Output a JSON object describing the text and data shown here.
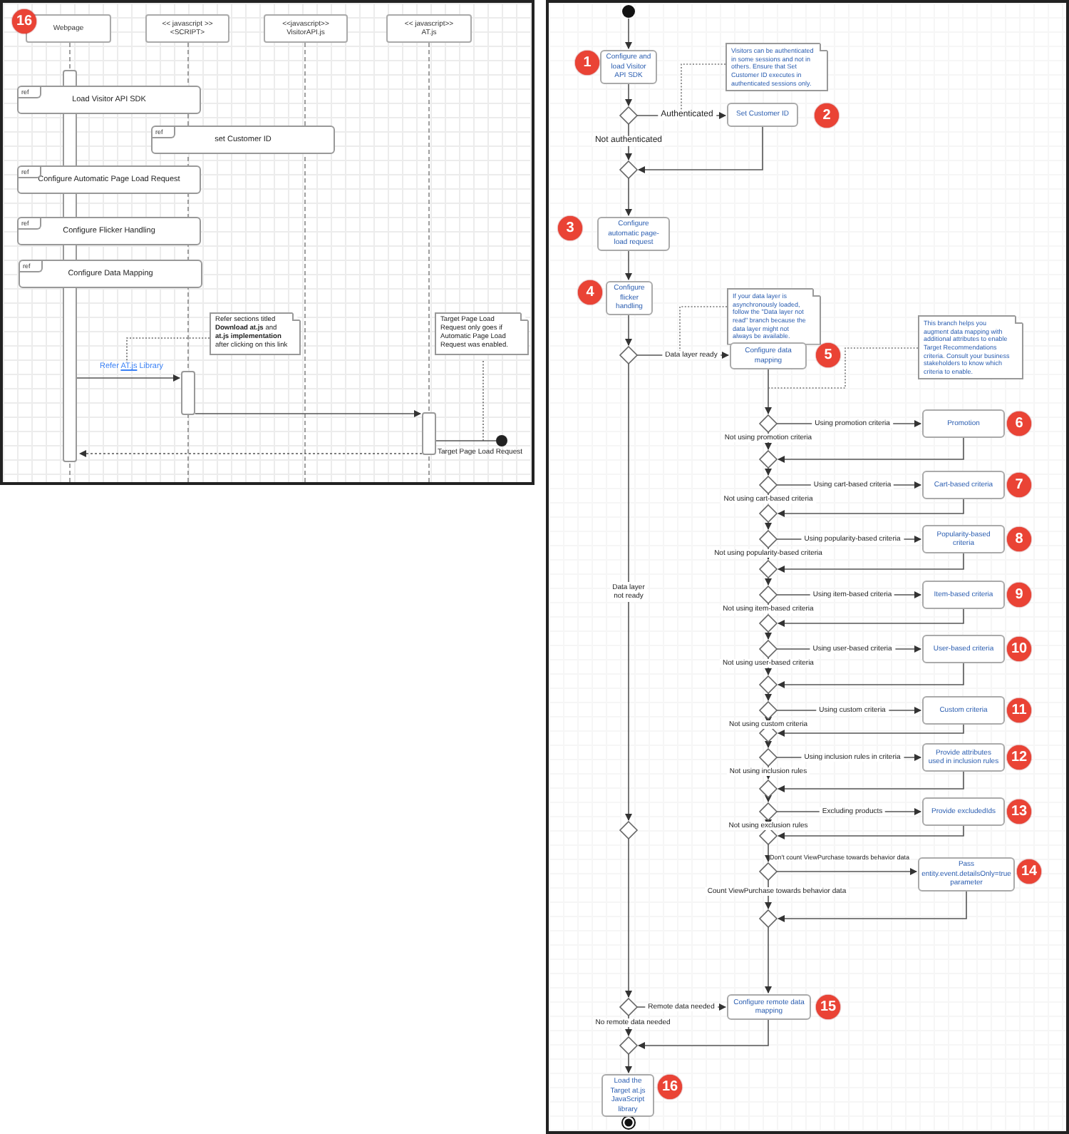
{
  "sequence_diagram": {
    "badge": "16",
    "lifelines": [
      {
        "title": "Webpage"
      },
      {
        "stereotype": "<< javascript >>",
        "title": "<SCRIPT>"
      },
      {
        "stereotype": "<<javascript>>",
        "title": "VisitorAPI.js"
      },
      {
        "stereotype": "<< javascript>>",
        "title": "AT.js"
      }
    ],
    "ref_frames": [
      {
        "tag": "ref",
        "label": "Load Visitor API SDK"
      },
      {
        "tag": "ref",
        "label": "set Customer ID"
      },
      {
        "tag": "ref",
        "label": "Configure Automatic Page Load Request"
      },
      {
        "tag": "ref",
        "label": "Configure Flicker Handling"
      },
      {
        "tag": "ref",
        "label": "Configure Data Mapping"
      }
    ],
    "notes": [
      "Refer sections titled **Download at.js** and **at.js implementation** after clicking on this link",
      "Target Page Load Request only goes if Automatic Page Load Request was enabled."
    ],
    "link_message": {
      "before": "Refer",
      "link": "AT.js",
      "after": "Library"
    },
    "return_message": "Target Page Load Request"
  },
  "activity_diagram": {
    "steps": [
      {
        "number": "1",
        "label": "Configure and load Visitor API SDK"
      },
      {
        "number": "2",
        "label": "Set Customer ID"
      },
      {
        "number": "3",
        "label": "Configure automatic page-load request"
      },
      {
        "number": "4",
        "label": "Configure flicker handling"
      },
      {
        "number": "5",
        "label": "Configure data mapping"
      },
      {
        "number": "6",
        "label": "Promotion"
      },
      {
        "number": "7",
        "label": "Cart-based criteria"
      },
      {
        "number": "8",
        "label": "Popularity-based criteria"
      },
      {
        "number": "9",
        "label": "Item-based criteria"
      },
      {
        "number": "10",
        "label": "User-based criteria"
      },
      {
        "number": "11",
        "label": "Custom criteria"
      },
      {
        "number": "12",
        "label": "Provide attributes used in inclusion rules"
      },
      {
        "number": "13",
        "label": "Provide excludedIds"
      },
      {
        "number": "14",
        "label": "Pass entity.event.detailsOnly=true parameter"
      },
      {
        "number": "15",
        "label": "Configure remote data mapping"
      },
      {
        "number": "16",
        "label": "Load the Target at.js JavaScript library"
      }
    ],
    "notes": [
      "Visitors can be authenticated in some sessions and not in others. Ensure that Set Customer ID executes in authenticated sessions only.",
      "If your data layer is asynchronously loaded, follow the \"Data layer not read\" branch because the data layer might not always be available.",
      "This branch helps you augment data mapping with additional attributes to enable Target Recommendations criteria. Consult your business stakeholders to know which criteria to enable."
    ],
    "branches": [
      {
        "taken": "Authenticated",
        "skipped": "Not authenticated"
      },
      {
        "taken": "Data layer ready",
        "skipped": "Data layer not ready"
      },
      {
        "taken": "Using promotion criteria",
        "skipped": "Not using promotion criteria"
      },
      {
        "taken": "Using cart-based criteria",
        "skipped": "Not using cart-based criteria"
      },
      {
        "taken": "Using popularity-based criteria",
        "skipped": "Not using popularity-based criteria"
      },
      {
        "taken": "Using item-based criteria",
        "skipped": "Not using item-based criteria"
      },
      {
        "taken": "Using user-based criteria",
        "skipped": "Not using user-based criteria"
      },
      {
        "taken": "Using custom criteria",
        "skipped": "Not using custom criteria"
      },
      {
        "taken": "Using inclusion rules in criteria",
        "skipped": "Not using inclusion rules"
      },
      {
        "taken": "Excluding products",
        "skipped": "Not using exclusion rules"
      },
      {
        "taken": "Don't count ViewPurchase towards behavior data",
        "skipped": "Count ViewPurchase towards behavior data"
      },
      {
        "taken": "Remote data needed",
        "skipped": "No remote data needed"
      }
    ]
  }
}
